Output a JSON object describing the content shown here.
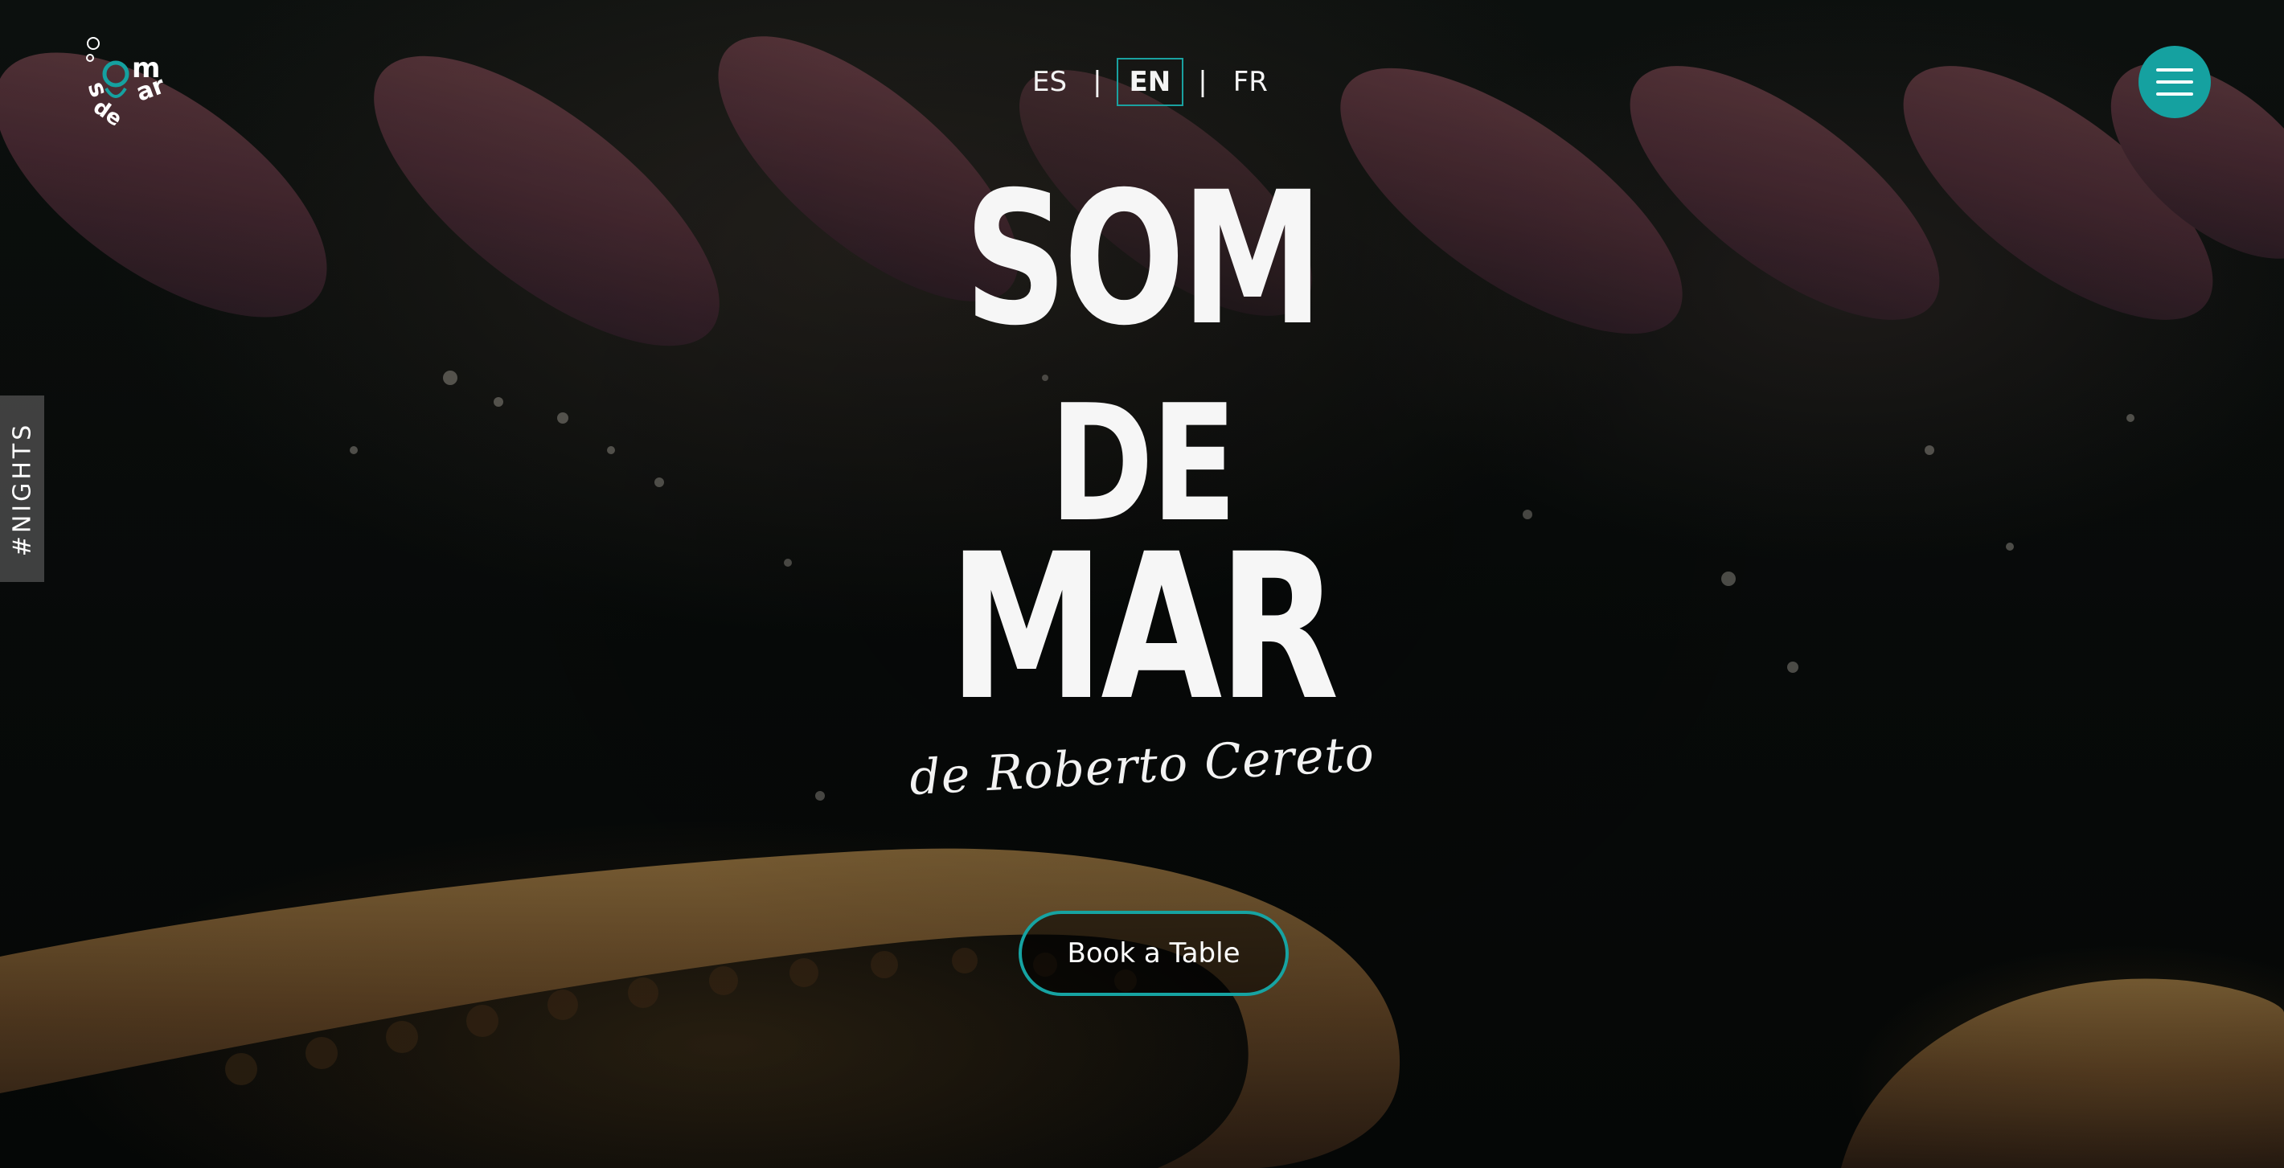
{
  "header": {
    "logo_alt": "Som de Mar",
    "languages": [
      {
        "code": "ES",
        "active": false
      },
      {
        "code": "EN",
        "active": true
      },
      {
        "code": "FR",
        "active": false
      }
    ],
    "separator": "|",
    "menu_icon": "hamburger-menu-icon"
  },
  "side_tab": {
    "label": "#NIGHTS"
  },
  "hero": {
    "title_line1": "SOM",
    "title_line2": "DE",
    "title_line3": "MAR",
    "subtitle": "de Roberto Cereto",
    "cta_label": "Book a Table"
  },
  "colors": {
    "accent": "#15a1a0",
    "text": "#f6f6f6",
    "background": "#050706"
  }
}
